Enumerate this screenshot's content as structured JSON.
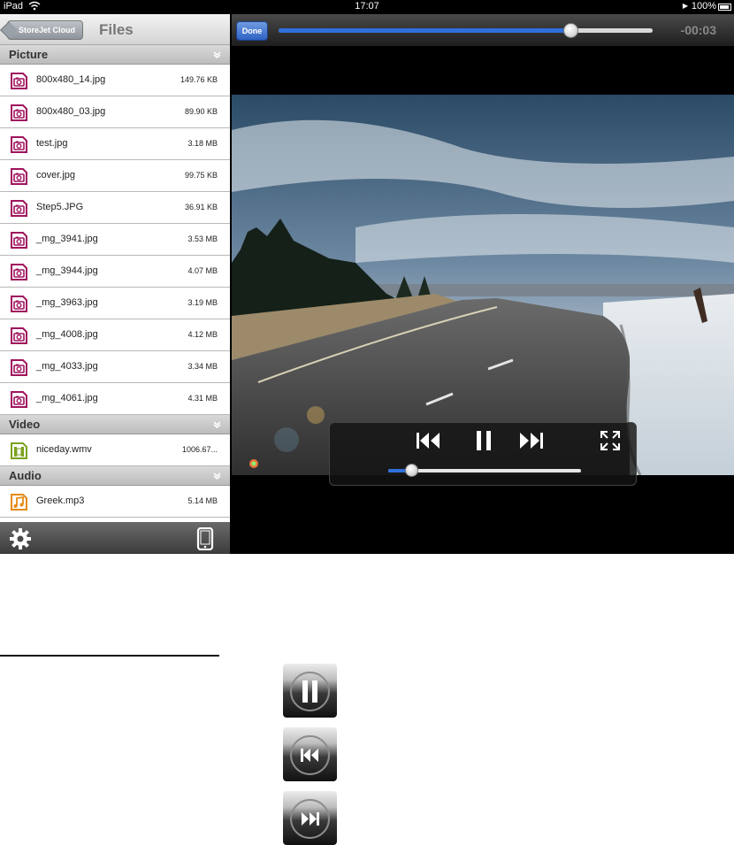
{
  "status_bar": {
    "device": "iPad",
    "time": "17:07",
    "battery": "100%"
  },
  "file_browser": {
    "back_label": "StoreJet Cloud",
    "title": "Files",
    "sections": [
      {
        "name": "Picture",
        "icon": "photo-file-icon",
        "files": [
          {
            "name": "800x480_14.jpg",
            "size": "149.76 KB"
          },
          {
            "name": "800x480_03.jpg",
            "size": "89.90 KB"
          },
          {
            "name": "test.jpg",
            "size": "3.18 MB"
          },
          {
            "name": "cover.jpg",
            "size": "99.75 KB"
          },
          {
            "name": "Step5.JPG",
            "size": "36.91 KB"
          },
          {
            "name": "_mg_3941.jpg",
            "size": "3.53 MB"
          },
          {
            "name": "_mg_3944.jpg",
            "size": "4.07 MB"
          },
          {
            "name": "_mg_3963.jpg",
            "size": "3.19 MB"
          },
          {
            "name": "_mg_4008.jpg",
            "size": "4.12 MB"
          },
          {
            "name": "_mg_4033.jpg",
            "size": "3.34 MB"
          },
          {
            "name": "_mg_4061.jpg",
            "size": "4.31 MB"
          }
        ]
      },
      {
        "name": "Video",
        "icon": "video-file-icon",
        "files": [
          {
            "name": "niceday.wmv",
            "size": "1006.67..."
          }
        ]
      },
      {
        "name": "Audio",
        "icon": "music-file-icon",
        "files": [
          {
            "name": "Greek.mp3",
            "size": "5.14 MB"
          }
        ]
      }
    ],
    "toolbar": {
      "left_icon": "gear-icon",
      "right_icon": "ipad-device-icon"
    }
  },
  "player": {
    "done_label": "Done",
    "time_remaining": "-00:03",
    "progress": 0.78,
    "volume": 0.12,
    "controls": [
      "rewind-icon",
      "pause-icon",
      "fast-forward-icon",
      "fullscreen-icon"
    ]
  },
  "legend_icons": [
    "pause-icon",
    "rewind-icon",
    "fast-forward-icon"
  ],
  "colors": {
    "accent_blue": "#2f6fdc",
    "photo_icon": "#a0145e",
    "video_icon": "#7ba21e",
    "audio_icon": "#e58a13"
  }
}
